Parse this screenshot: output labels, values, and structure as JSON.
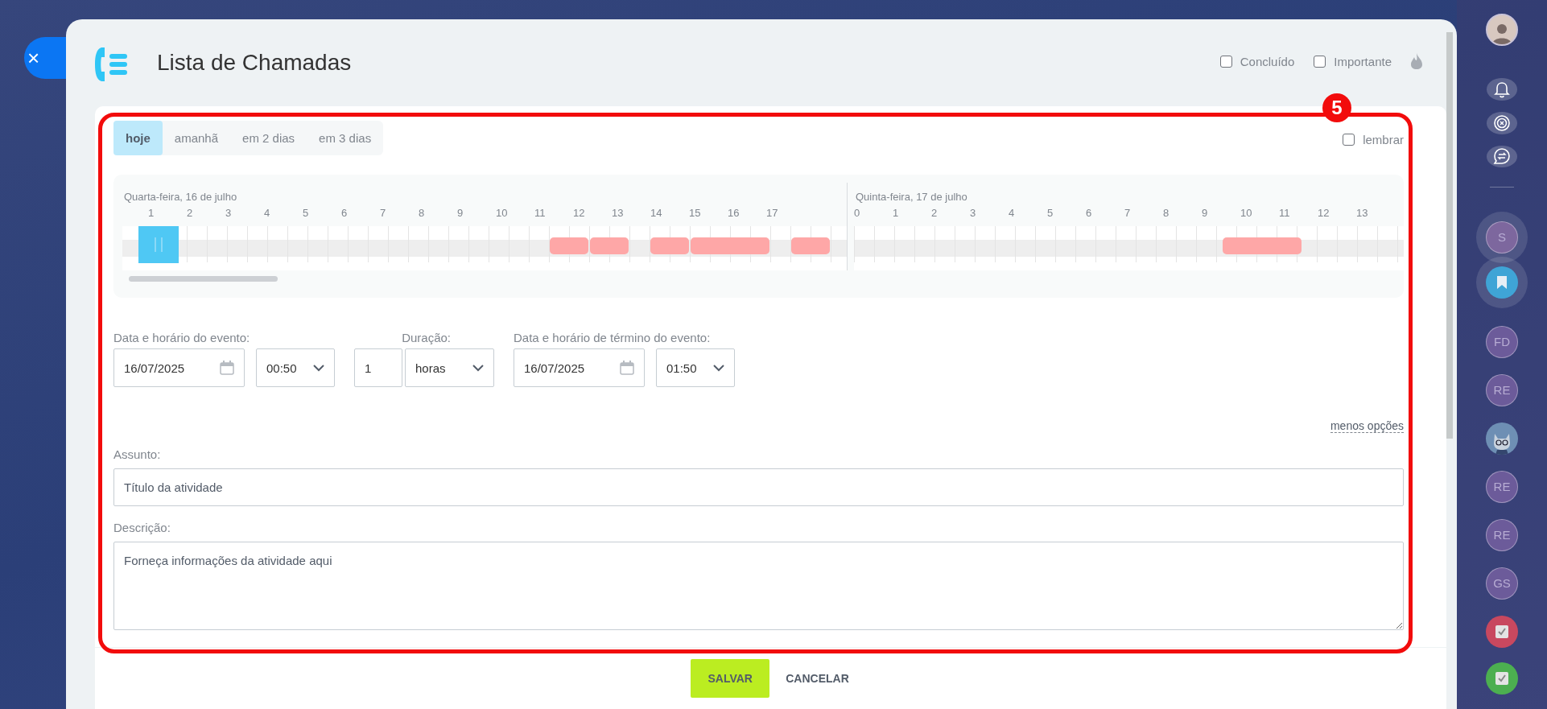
{
  "close_button": {
    "label": "×"
  },
  "header": {
    "title": "Lista de Chamadas",
    "checkboxes": [
      {
        "label": "Concluído",
        "checked": false
      },
      {
        "label": "Importante",
        "checked": false
      }
    ]
  },
  "annotation": {
    "badge": "5"
  },
  "tabs": [
    {
      "label": "hoje",
      "selected": true
    },
    {
      "label": "amanhã",
      "selected": false
    },
    {
      "label": "em 2 dias",
      "selected": false
    },
    {
      "label": "em 3 dias",
      "selected": false
    }
  ],
  "remind": {
    "label": "lembrar",
    "checked": false
  },
  "timeline": {
    "days": [
      {
        "label": "Quarta-feira, 16 de julho",
        "hours": [
          "1",
          "2",
          "3",
          "4",
          "5",
          "6",
          "7",
          "8",
          "9",
          "10",
          "11",
          "12",
          "13",
          "14",
          "15",
          "16",
          "17"
        ]
      },
      {
        "label": "Quinta-feira, 17 de julho",
        "hours": [
          "0",
          "1",
          "2",
          "3",
          "4",
          "5",
          "6",
          "7",
          "8",
          "9",
          "10",
          "11",
          "12",
          "13"
        ]
      }
    ]
  },
  "form": {
    "start_label": "Data e horário do evento:",
    "start_date": "16/07/2025",
    "start_time": "00:50",
    "duration_label": "Duração:",
    "duration_value": "1",
    "duration_unit": "horas",
    "end_label": "Data e horário de término do evento:",
    "end_date": "16/07/2025",
    "end_time": "01:50",
    "less_options": "menos opções",
    "subject_label": "Assunto:",
    "subject_placeholder": "Título da atividade",
    "description_label": "Descrição:",
    "description_placeholder": "Forneça informações da atividade aqui"
  },
  "footer": {
    "buttons": [
      "SALVAR",
      "CANCELAR"
    ]
  },
  "sidebar": {
    "items": [
      {
        "kind": "photo"
      },
      {
        "kind": "bell"
      },
      {
        "kind": "target"
      },
      {
        "kind": "chat"
      },
      {
        "kind": "divider"
      },
      {
        "kind": "initials",
        "label": "S"
      },
      {
        "kind": "bookmark"
      },
      {
        "kind": "initials",
        "label": "FD"
      },
      {
        "kind": "initials",
        "label": "RE"
      },
      {
        "kind": "cat"
      },
      {
        "kind": "initials",
        "label": "RE"
      },
      {
        "kind": "initials",
        "label": "RE"
      },
      {
        "kind": "initials",
        "label": "GS"
      },
      {
        "kind": "task",
        "color": "#c8485f"
      },
      {
        "kind": "task",
        "color": "#4caf50"
      }
    ]
  }
}
